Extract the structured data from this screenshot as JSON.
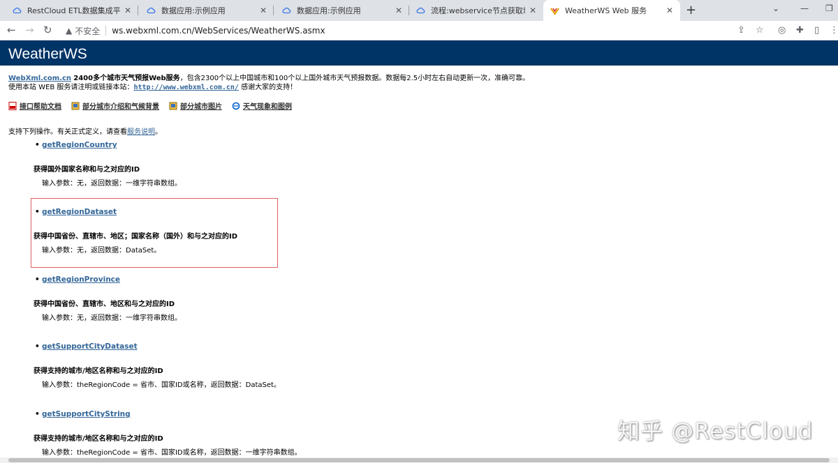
{
  "browser": {
    "tabs": [
      {
        "title": "RestCloud ETL数据集成平台",
        "icon": "cloud-icon",
        "active": false
      },
      {
        "title": "数据应用:示例应用",
        "icon": "cloud-icon",
        "active": false
      },
      {
        "title": "数据应用:示例应用",
        "icon": "cloud-icon",
        "active": false
      },
      {
        "title": "流程:webservice节点获取城市列",
        "icon": "cloud-icon",
        "active": false
      },
      {
        "title": "WeatherWS Web 服务",
        "icon": "weather-icon",
        "active": true
      }
    ],
    "new_tab": "+",
    "security_label": "不安全",
    "url": "ws.webxml.com.cn/WebServices/WeatherWS.asmx"
  },
  "page": {
    "banner_title": "WeatherWS",
    "intro": {
      "site_link": "WebXml.com.cn",
      "headline": "2400多个城市天气预报Web服务",
      "text1": "，包含2300个以上中国城市和100个以上国外城市天气预报数据。数据每2.5小时左右自动更新一次，准确可靠。",
      "line2_prefix": "使用本站 WEB 服务请注明或链接本站：",
      "line2_link": "http://www.webxml.com.cn/",
      "line2_suffix": " 感谢大家的支持！"
    },
    "links": [
      {
        "label": "接口帮助文档",
        "icon": "pdf-icon"
      },
      {
        "label": "部分城市介绍和气候背景",
        "icon": "book-icon"
      },
      {
        "label": "部分城市图片",
        "icon": "book-icon"
      },
      {
        "label": "天气现象和图例",
        "icon": "ie-icon"
      }
    ],
    "support_prefix": "支持下列操作。有关正式定义，请查看",
    "support_link": "服务说明",
    "support_suffix": "。",
    "operations": [
      {
        "name": "getRegionCountry",
        "title": "获得国外国家名称和与之对应的ID",
        "desc": "输入参数：无，返回数据：一维字符串数组。"
      },
      {
        "name": "getRegionDataset",
        "title": "获得中国省份、直辖市、地区；国家名称（国外）和与之对应的ID",
        "desc": "输入参数：无，返回数据：DataSet。"
      },
      {
        "name": "getRegionProvince",
        "title": "获得中国省份、直辖市、地区和与之对应的ID",
        "desc": "输入参数：无，返回数据：一维字符串数组。"
      },
      {
        "name": "getSupportCityDataset",
        "title": "获得支持的城市/地区名称和与之对应的ID",
        "desc": "输入参数：theRegionCode = 省市、国家ID或名称，返回数据：DataSet。"
      },
      {
        "name": "getSupportCityString",
        "title": "获得支持的城市/地区名称和与之对应的ID",
        "desc": "输入参数：theRegionCode = 省市、国家ID或名称，返回数据：一维字符串数组。"
      }
    ],
    "watermark": "知乎 @RestCloud"
  }
}
